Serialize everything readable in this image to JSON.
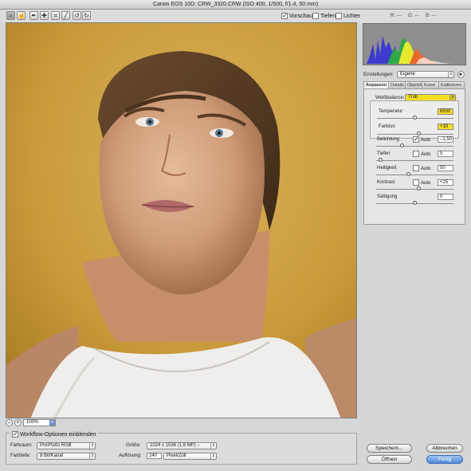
{
  "window": {
    "title": "Canon EOS 10D:  CRW_3320.CRW  (ISO 400, 1/500, f/1.4, 50 mm)"
  },
  "toolbar": {
    "tools": [
      {
        "name": "zoom-tool-icon",
        "glyph": "⌕",
        "active": true
      },
      {
        "name": "hand-tool-icon",
        "glyph": "☝"
      },
      {
        "name": "eyedropper-tool-icon",
        "glyph": "✒"
      },
      {
        "name": "color-sampler-tool-icon",
        "glyph": "✚"
      },
      {
        "name": "crop-tool-icon",
        "glyph": "⌗"
      },
      {
        "name": "straighten-tool-icon",
        "glyph": "╱"
      },
      {
        "name": "rotate-left-icon",
        "glyph": "↺"
      },
      {
        "name": "rotate-right-icon",
        "glyph": "↻"
      }
    ],
    "preview_label": "Vorschau",
    "preview_checked": true,
    "shadows_label": "Tiefen",
    "shadows_checked": false,
    "highlights_label": "Lichter",
    "highlights_checked": false,
    "rgb_r": "R:  ---",
    "rgb_g": "G:  ---",
    "rgb_b": "B:  ---"
  },
  "zoom": {
    "minus": "–",
    "plus": "+",
    "value": "100%"
  },
  "settings": {
    "label": "Einstellungen:",
    "value": "Eigene",
    "menu_icon": "▸"
  },
  "tabs": [
    "Anpassen",
    "Details",
    "Objektiv",
    "Kurve",
    "Kalibrieren"
  ],
  "white_balance": {
    "label": "Weißbalance:",
    "value": "Trüb",
    "temperature_label": "Temperatur",
    "temperature_value": "6500",
    "temperature_level": 0.5,
    "tint_label": "Farbton",
    "tint_value": "+10",
    "tint_level": 0.55
  },
  "adjustments": [
    {
      "label": "Belichtung",
      "auto": true,
      "auto_label": "Auto",
      "value": "–1,50",
      "level": 0.34
    },
    {
      "label": "Tiefen",
      "auto": false,
      "auto_label": "Auto",
      "value": "5",
      "level": 0.06
    },
    {
      "label": "Helligkeit",
      "auto": false,
      "auto_label": "Auto",
      "value": "50",
      "level": 0.42
    },
    {
      "label": "Kontrast",
      "auto": false,
      "auto_label": "Auto",
      "value": "+25",
      "level": 0.56
    },
    {
      "label": "Sättigung",
      "auto": null,
      "auto_label": "",
      "value": "0",
      "level": 0.5
    }
  ],
  "workflow": {
    "toggle_label": "Workflow-Optionen einblenden",
    "toggle_checked": true,
    "colorspace_label": "Farbraum:",
    "colorspace_value": "ProPhoto RGB",
    "depth_label": "Farbtiefe:",
    "depth_value": "8 Bit/Kanal",
    "size_label": "Größe:",
    "size_value": "1024 x 1536 (1,6 MP) –",
    "resolution_label": "Auflösung:",
    "resolution_value": "240",
    "resolution_unit": "Pixel/Zoll"
  },
  "buttons": {
    "save": "Speichern...",
    "cancel": "Abbrechen",
    "open": "Öffnen",
    "done": "Fertig"
  },
  "colors": {
    "wb_highlight": "#f3df25",
    "default_button": "#4f8ad9",
    "background_wall": "#c99b3c"
  }
}
